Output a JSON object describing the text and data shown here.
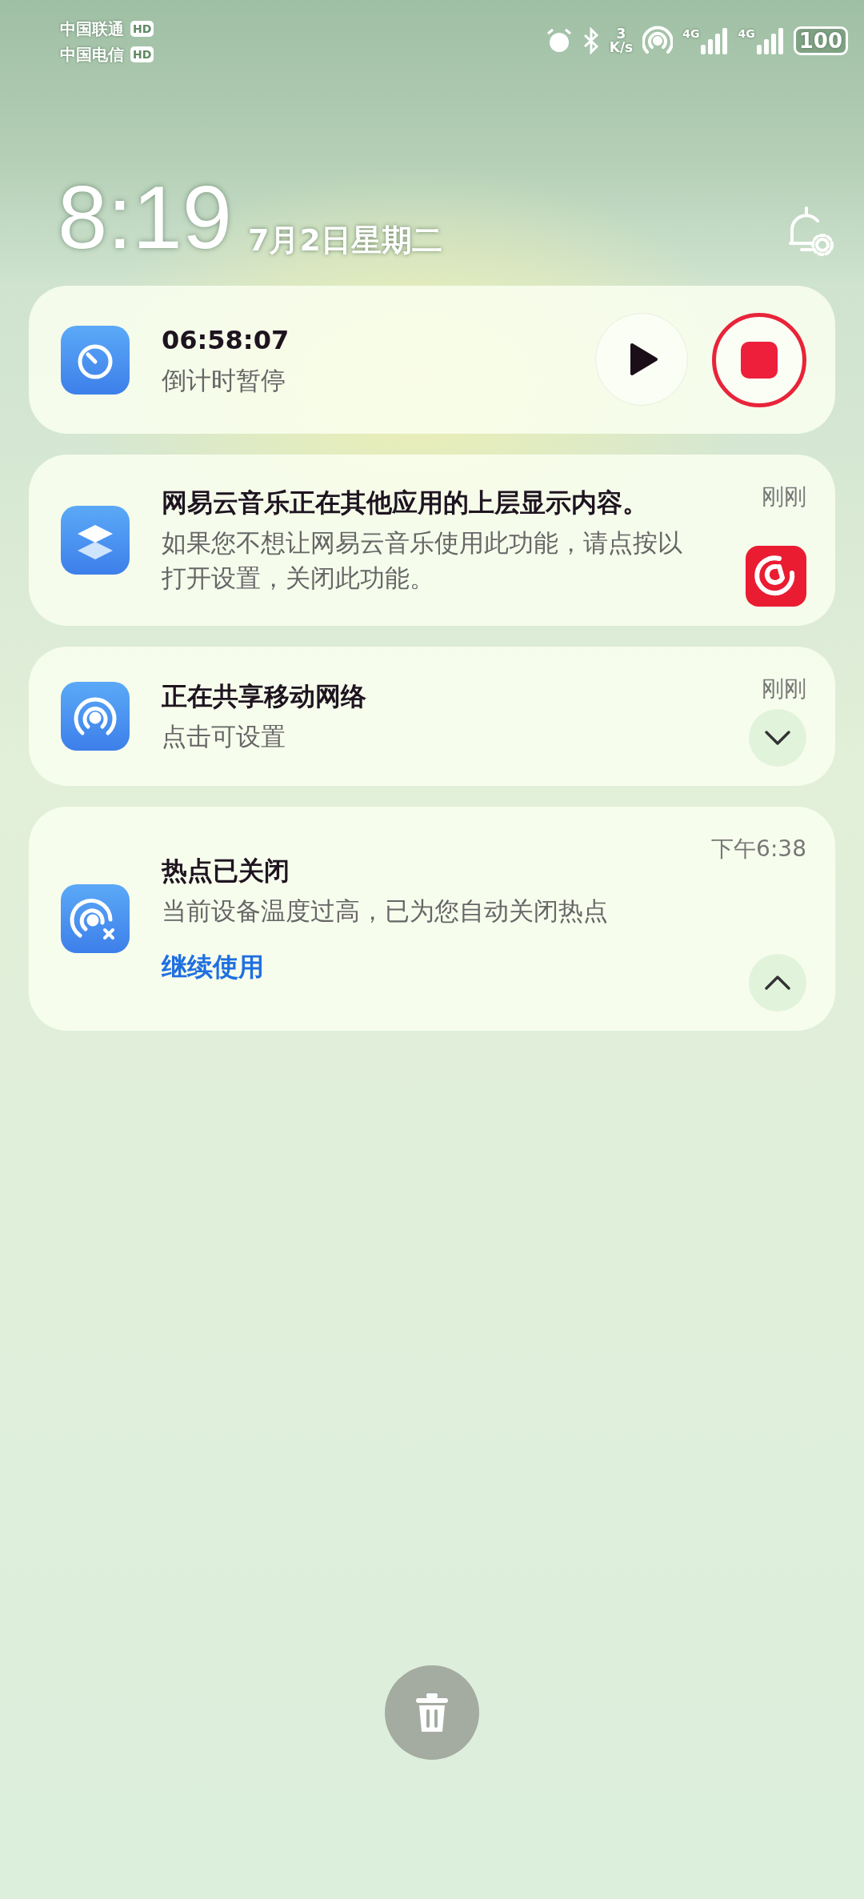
{
  "status_bar": {
    "carriers": [
      {
        "name": "中国联通",
        "badge": "HD"
      },
      {
        "name": "中国电信",
        "badge": "HD"
      }
    ],
    "speed_value": "3",
    "speed_unit": "K/s",
    "networks": [
      "4G",
      "4G"
    ],
    "battery": "100"
  },
  "lockscreen": {
    "time": "8:19",
    "date": "7月2日星期二"
  },
  "notifications": [
    {
      "kind": "timer",
      "title": "06:58:07",
      "text": "倒计时暂停"
    },
    {
      "kind": "overlay",
      "title": "网易云音乐正在其他应用的上层显示内容。",
      "text": "如果您不想让网易云音乐使用此功能，请点按以打开设置，关闭此功能。",
      "time": "刚刚"
    },
    {
      "kind": "hotspot",
      "title": "正在共享移动网络",
      "text": "点击可设置",
      "time": "刚刚",
      "expanded": false
    },
    {
      "kind": "hotspot_off",
      "title": "热点已关闭",
      "text": "当前设备温度过高，已为您自动关闭热点",
      "time": "下午6:38",
      "action": "继续使用",
      "expanded": true
    }
  ]
}
